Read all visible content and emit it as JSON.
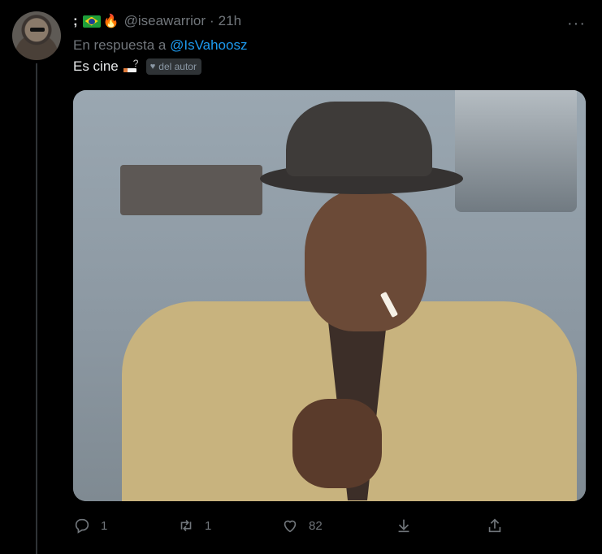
{
  "tweet": {
    "display_name": ";",
    "flag_icon": "brazil-flag-icon",
    "fire_icon": "fire-icon",
    "handle": "@iseawarrior",
    "separator": "·",
    "time": "21h",
    "more_icon": "more-icon",
    "reply_prefix": "En respuesta a",
    "reply_to": "@IsVahoosz",
    "text": "Es cine",
    "smoke_glyph": "?",
    "author_badge": "del autor",
    "media_alt": "animated-gif-man-smoking"
  },
  "actions": {
    "reply_count": "1",
    "retweet_count": "1",
    "like_count": "82"
  },
  "colors": {
    "background": "#000000",
    "text": "#e7e9ea",
    "muted": "#71767b",
    "accent": "#1d9bf0",
    "badge_bg": "#2f3336"
  }
}
